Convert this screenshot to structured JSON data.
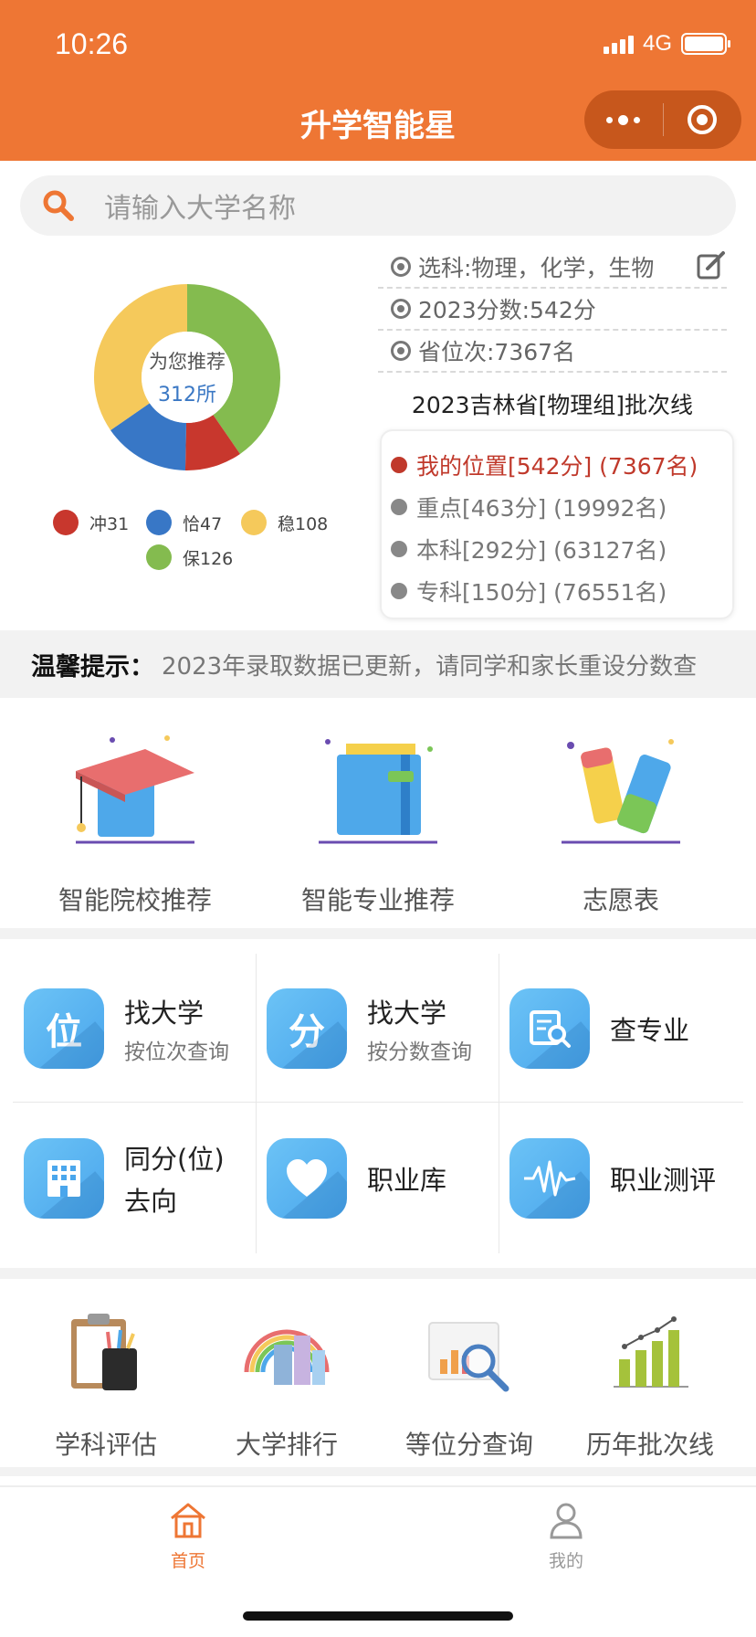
{
  "status_bar": {
    "time": "10:26",
    "network": "4G"
  },
  "nav": {
    "title": "升学智能星"
  },
  "search": {
    "placeholder": "请输入大学名称"
  },
  "recommend": {
    "center_label": "为您推荐",
    "center_value": "312所",
    "segments": [
      {
        "label": "冲31",
        "value": 31,
        "color": "#C8372D"
      },
      {
        "label": "恰47",
        "value": 47,
        "color": "#3877C6"
      },
      {
        "label": "稳108",
        "value": 108,
        "color": "#F5C95B"
      },
      {
        "label": "保126",
        "value": 126,
        "color": "#84BB4F"
      }
    ]
  },
  "info": {
    "subjects": "选科:物理，化学，生物",
    "score": "2023分数:542分",
    "rank": "省位次:7367名",
    "batch_title": "2023吉林省[物理组]批次线",
    "batch_lines": [
      "我的位置[542分] (7367名)",
      "重点[463分] (19992名)",
      "本科[292分] (63127名)",
      "专科[150分] (76551名)"
    ]
  },
  "tip": {
    "label": "温馨提示：",
    "text": "2023年录取数据已更新，请同学和家长重设分数查"
  },
  "features": [
    "智能院校推荐",
    "智能专业推荐",
    "志愿表"
  ],
  "grid": [
    {
      "icon_char": "位",
      "icon": "position-icon",
      "main": "找大学",
      "sub": "按位次查询"
    },
    {
      "icon_char": "分",
      "icon": "score-icon",
      "main": "找大学",
      "sub": "按分数查询"
    },
    {
      "icon_char": "",
      "icon": "search-document-icon",
      "main": "查专业",
      "sub": ""
    },
    {
      "icon_char": "",
      "icon": "building-icon",
      "main": "同分(位)",
      "main2": "去向",
      "sub": ""
    },
    {
      "icon_char": "",
      "icon": "heart-icon",
      "main": "职业库",
      "sub": ""
    },
    {
      "icon_char": "",
      "icon": "wave-icon",
      "main": "职业测评",
      "sub": ""
    }
  ],
  "tools": [
    "学科评估",
    "大学排行",
    "等位分查询",
    "历年批次线"
  ],
  "tabbar": {
    "home": "首页",
    "mine": "我的",
    "active_color": "#EE7634",
    "inactive_color": "#999999"
  }
}
